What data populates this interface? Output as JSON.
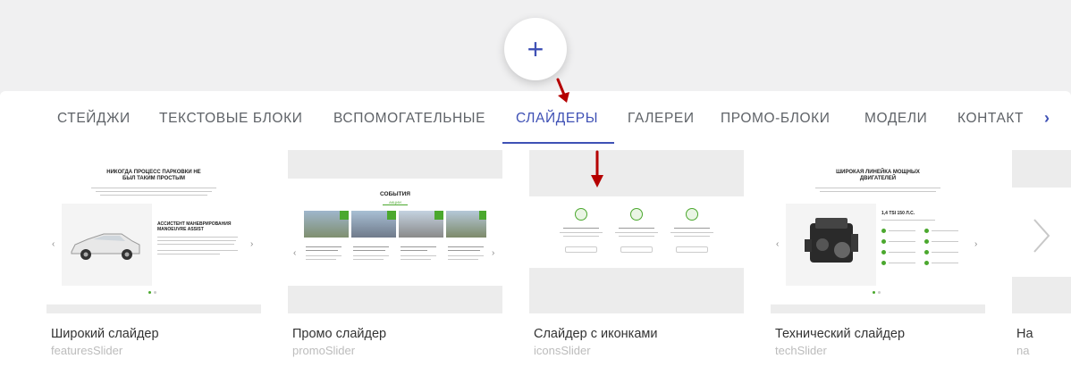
{
  "tabs": [
    {
      "label": "СТЕЙДЖИ",
      "active": false
    },
    {
      "label": "ТЕКСТОВЫЕ БЛОКИ",
      "active": false
    },
    {
      "label": "ВСПОМОГАТЕЛЬНЫЕ",
      "active": false
    },
    {
      "label": "СЛАЙДЕРЫ",
      "active": true
    },
    {
      "label": "ГАЛЕРЕИ",
      "active": false
    },
    {
      "label": "ПРОМО-БЛОКИ",
      "active": false
    },
    {
      "label": "МОДЕЛИ",
      "active": false
    },
    {
      "label": "КОНТАКТ",
      "active": false
    }
  ],
  "tabs_next_icon": "chevron-right-icon",
  "add_button_icon": "plus-icon",
  "accent_color": "#3f51b5",
  "annotation_color": "#b50000",
  "cards": [
    {
      "title": "Широкий слайдер",
      "subtitle": "featuresSlider",
      "thumb_heading": "НИКОГДА ПРОЦЕСС ПАРКОВКИ НЕ БЫЛ ТАКИМ ПРОСТЫМ",
      "thumb_feature": "АССИСТЕНТ МАНЕВРИРОВАНИЯ MANOEUVRE ASSIST"
    },
    {
      "title": "Промо слайдер",
      "subtitle": "promoSlider",
      "thumb_heading": "СОБЫТИЯ",
      "thumb_tab": "АКЦИИ"
    },
    {
      "title": "Слайдер с иконками",
      "subtitle": "iconsSlider"
    },
    {
      "title": "Технический слайдер",
      "subtitle": "techSlider",
      "thumb_heading": "ШИРОКАЯ ЛИНЕЙКА МОЩНЫХ ДВИГАТЕЛЕЙ",
      "thumb_engine": "1,4 TSI 150 Л.С."
    },
    {
      "title": "На",
      "subtitle": "na"
    }
  ],
  "slider_next_icon": "chevron-right-icon"
}
